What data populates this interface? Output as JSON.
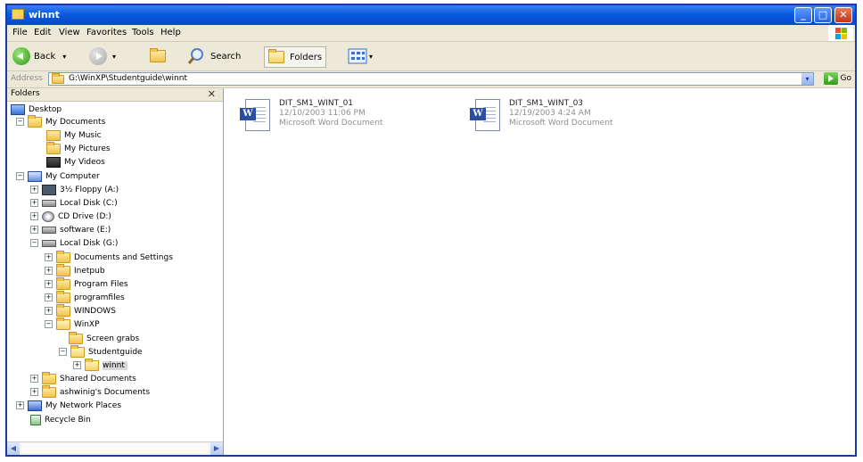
{
  "window": {
    "title": "winnt",
    "min_glyph": "_",
    "max_glyph": "□",
    "close_glyph": "✕"
  },
  "menu": {
    "items": [
      "File",
      "Edit",
      "View",
      "Favorites",
      "Tools",
      "Help"
    ]
  },
  "toolbar": {
    "back_label": "Back",
    "search_label": "Search",
    "folders_label": "Folders",
    "dropdown_glyph": "▾"
  },
  "address": {
    "label": "Address",
    "value": "G:\\WinXP\\Studentguide\\winnt",
    "go_label": "Go"
  },
  "folders_pane": {
    "title": "Folders",
    "close_glyph": "✕"
  },
  "tree": {
    "expand_plus": "+",
    "expand_minus": "−",
    "desktop": "Desktop",
    "my_documents": "My Documents",
    "my_music": "My Music",
    "my_pictures": "My Pictures",
    "my_videos": "My Videos",
    "my_computer": "My Computer",
    "floppy": "3½ Floppy (A:)",
    "local_c": "Local Disk (C:)",
    "cd_drive": "CD Drive (D:)",
    "software_e": "software (E:)",
    "local_g": "Local Disk (G:)",
    "docs_settings": "Documents and Settings",
    "inetpub": "Inetpub",
    "program_files": "Program Files",
    "programfiles": "programfiles",
    "windows": "WINDOWS",
    "winxp": "WinXP",
    "screen_grabs": "Screen grabs",
    "studentguide": "Studentguide",
    "winnt": "winnt",
    "shared_documents": "Shared Documents",
    "user_documents": "ashwinig's Documents",
    "my_network_places": "My Network Places",
    "recycle_bin": "Recycle Bin"
  },
  "files": [
    {
      "name": "DIT_SM1_WINT_01",
      "date": "12/10/2003 11:06 PM",
      "type": "Microsoft Word Document",
      "icon": "word-document-icon",
      "icon_letter": "W"
    },
    {
      "name": "DIT_SM1_WINT_03",
      "date": "12/19/2003 4:24 AM",
      "type": "Microsoft Word Document",
      "icon": "word-document-icon",
      "icon_letter": "W"
    }
  ],
  "scrollbar": {
    "left_glyph": "◀",
    "right_glyph": "▶"
  },
  "colors": {
    "titlebar": "#0a5ae0",
    "window_frame": "#1a3c9e",
    "word_icon": "#2a4fa0",
    "folder": "#f1c24f"
  }
}
